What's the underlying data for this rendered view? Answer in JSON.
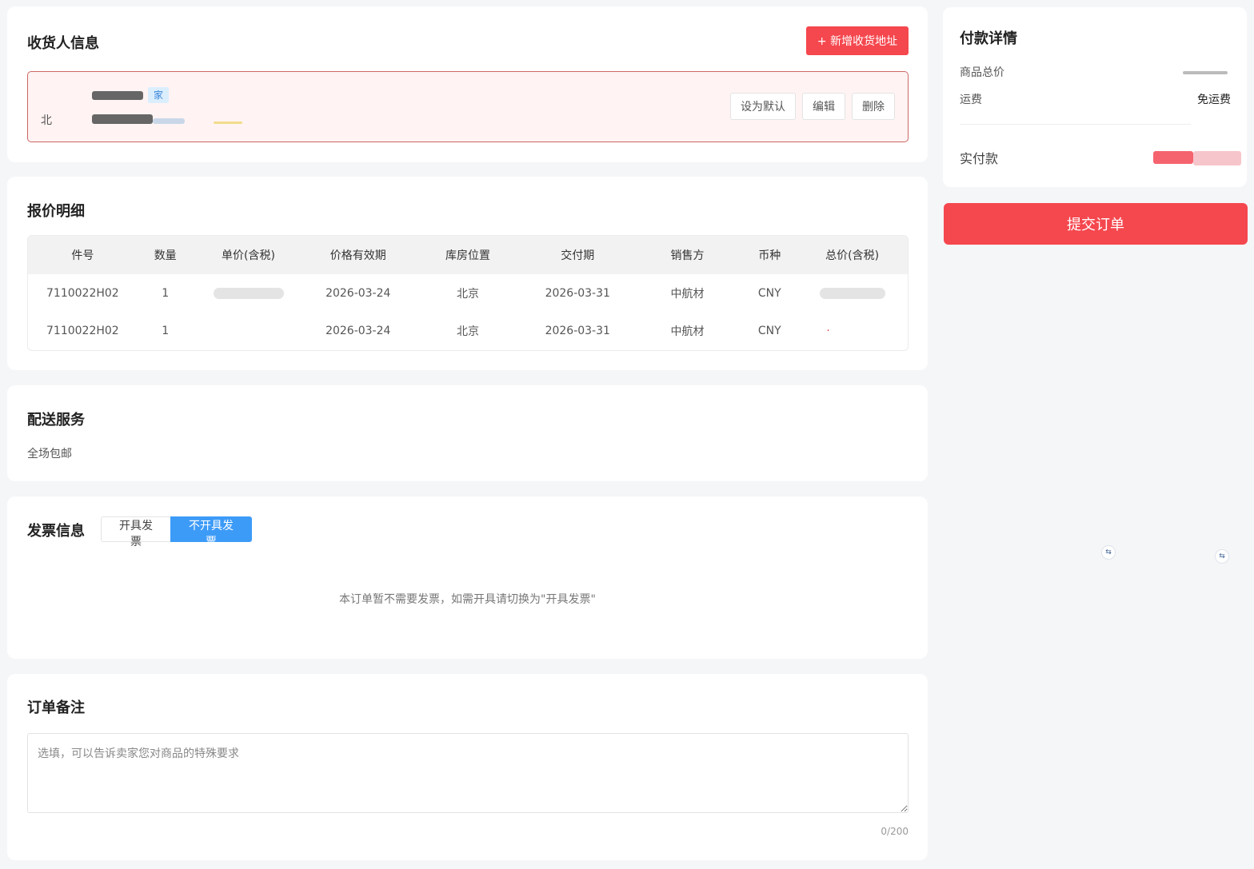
{
  "consignee": {
    "title": "收货人信息",
    "add_button": "+ 新增收货地址",
    "address_tag": "家",
    "address_prefix": "北",
    "actions": {
      "set_default": "设为默认",
      "edit": "编辑",
      "delete": "删除"
    }
  },
  "quote": {
    "title": "报价明细",
    "columns": [
      "件号",
      "数量",
      "单价(含税)",
      "价格有效期",
      "库房位置",
      "交付期",
      "销售方",
      "币种",
      "总价(含税)"
    ],
    "rows": [
      {
        "part": "7110022H02",
        "qty": "1",
        "valid": "2026-03-24",
        "location": "北京",
        "delivery": "2026-03-31",
        "seller": "中航材",
        "currency": "CNY"
      },
      {
        "part": "7110022H02",
        "qty": "1",
        "valid": "2026-03-24",
        "location": "北京",
        "delivery": "2026-03-31",
        "seller": "中航材",
        "currency": "CNY"
      }
    ]
  },
  "delivery": {
    "title": "配送服务",
    "text": "全场包邮"
  },
  "invoice": {
    "title": "发票信息",
    "option_issue": "开具发票",
    "option_no_issue": "不开具发票",
    "message": "本订单暂不需要发票，如需开具请切换为\"开具发票\""
  },
  "remark": {
    "title": "订单备注",
    "placeholder": "选填，可以告诉卖家您对商品的特殊要求",
    "counter": "0/200"
  },
  "payment": {
    "title": "付款详情",
    "goods_total_label": "商品总价",
    "shipping_label": "运费",
    "shipping_value": "免运费",
    "actual_label": "实付款",
    "submit": "提交订单"
  },
  "colors": {
    "accent_red": "#f5474e",
    "accent_blue": "#3d9bf8"
  }
}
